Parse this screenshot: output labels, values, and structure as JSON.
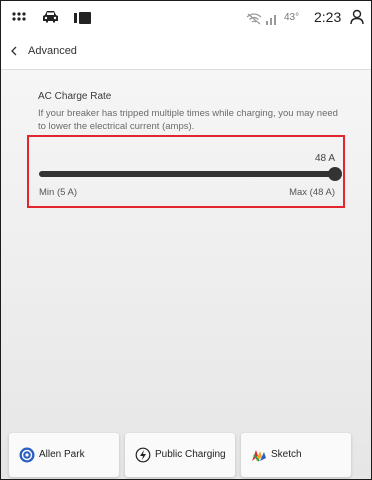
{
  "status_bar": {
    "icons": [
      "apps-grid-icon",
      "car-icon",
      "media-icon",
      "wifi-off-icon",
      "profile-icon"
    ],
    "temperature": "43°",
    "time": "2:23"
  },
  "header": {
    "back_icon": "chevron-left-icon",
    "title": "Advanced"
  },
  "charge_rate": {
    "title": "AC Charge Rate",
    "description": "If your breaker has tripped multiple times while charging, you may need to lower the electrical current (amps).",
    "current_value": "48 A",
    "min_label": "Min (5 A)",
    "max_label": "Max (48 A)",
    "value_amps": 48,
    "min_amps": 5,
    "max_amps": 48
  },
  "shortcuts": [
    {
      "label": "Allen Park",
      "icon": "location-pin-icon"
    },
    {
      "label": "Public Charging",
      "icon": "charging-bolt-icon"
    },
    {
      "label": "Sketch",
      "icon": "sketch-app-icon"
    }
  ],
  "colors": {
    "highlight": "#e3262d",
    "slider_fill": "#333333",
    "accent_blue": "#2d5ec2"
  }
}
